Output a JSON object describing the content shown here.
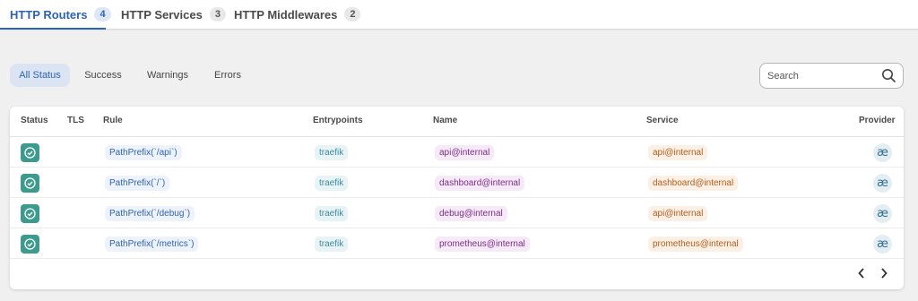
{
  "tabs": [
    {
      "label": "HTTP Routers",
      "count": "4"
    },
    {
      "label": "HTTP Services",
      "count": "3"
    },
    {
      "label": "HTTP Middlewares",
      "count": "2"
    }
  ],
  "filters": [
    "All Status",
    "Success",
    "Warnings",
    "Errors"
  ],
  "search": {
    "placeholder": "Search"
  },
  "table": {
    "headers": {
      "status": "Status",
      "tls": "TLS",
      "rule": "Rule",
      "entrypoints": "Entrypoints",
      "name": "Name",
      "service": "Service",
      "provider": "Provider"
    },
    "rows": [
      {
        "rule": "PathPrefix(`/api`)",
        "entrypoint": "traefik",
        "name": "api@internal",
        "service": "api@internal",
        "provider": "æ"
      },
      {
        "rule": "PathPrefix(`/`)",
        "entrypoint": "traefik",
        "name": "dashboard@internal",
        "service": "dashboard@internal",
        "provider": "æ"
      },
      {
        "rule": "PathPrefix(`/debug`)",
        "entrypoint": "traefik",
        "name": "debug@internal",
        "service": "api@internal",
        "provider": "æ"
      },
      {
        "rule": "PathPrefix(`/metrics`)",
        "entrypoint": "traefik",
        "name": "prometheus@internal",
        "service": "prometheus@internal",
        "provider": "æ"
      }
    ]
  },
  "pagination": {
    "prev_icon": "chevron-left-icon",
    "next_icon": "chevron-right-icon"
  },
  "colors": {
    "accent": "#2d63b3",
    "success": "#3d9b8e"
  }
}
